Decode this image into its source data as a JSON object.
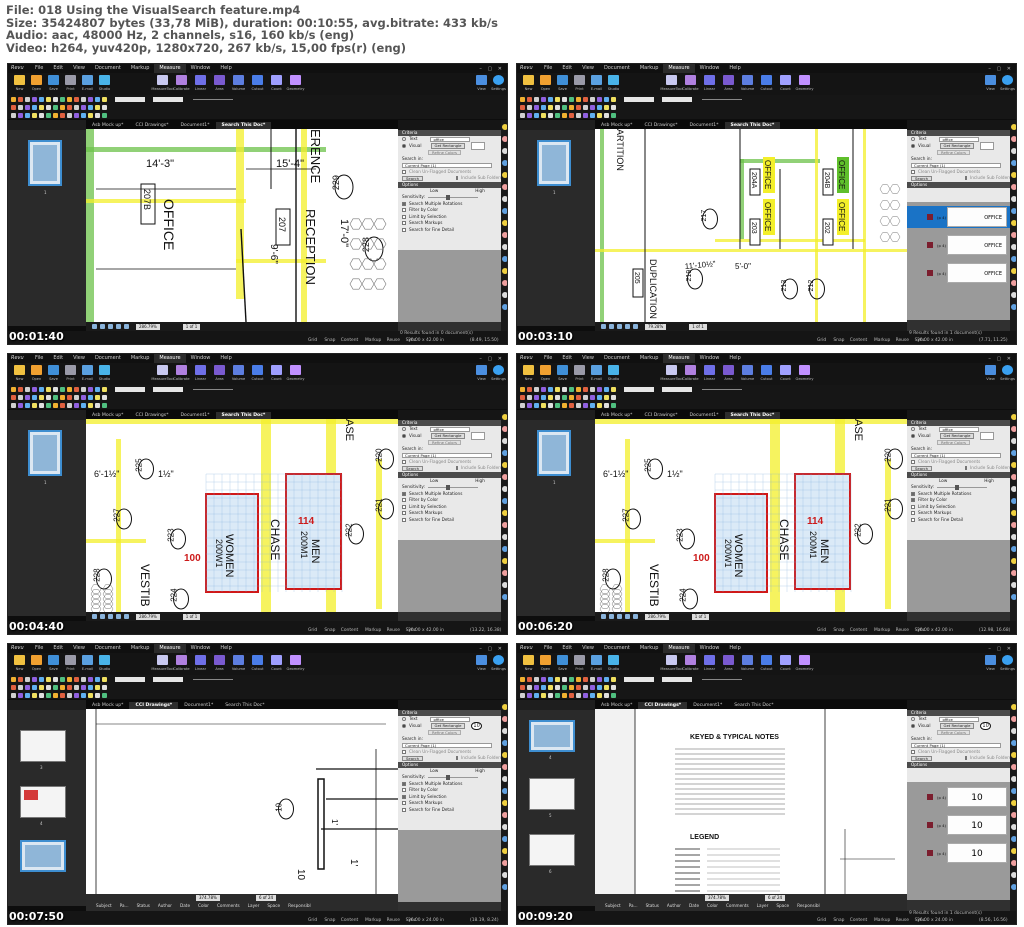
{
  "header": {
    "line1": "File: 018 Using the VisualSearch feature.mp4",
    "line2": "Size: 35424807 bytes (33,78 MiB), duration: 00:10:55, avg.bitrate: 433 kb/s",
    "line3": "Audio: aac, 48000 Hz, 2 channels, s16, 160 kb/s (eng)",
    "line4": "Video: h264, yuv420p, 1280x720, 267 kb/s, 15,00 fps(r) (eng)"
  },
  "app": {
    "logo": "Revu",
    "menu": [
      "File",
      "Edit",
      "View",
      "Document",
      "Markup",
      "Measure",
      "Window",
      "Help"
    ],
    "active_menu": "Measure",
    "ribbon_left": [
      "New",
      "Open",
      "Save",
      "Print",
      "E-mail",
      "Studio"
    ],
    "ribbon_measure": [
      "MeasureTool",
      "Calibrate",
      "Linear",
      "Area",
      "Volume",
      "Cutout",
      "Count",
      "Geometry"
    ],
    "ribbon_right": [
      "View",
      "Settings"
    ],
    "colors": {
      "accent": "#3e8ed0",
      "highlight_yellow": "#f3ef2a",
      "highlight_green": "#6cc24a",
      "result_swatch": "#7b1e2e",
      "select_blue": "#1a73c6"
    }
  },
  "search": {
    "section_criteria": "Criteria",
    "text_option": "Text",
    "visual_option": "Visual",
    "get_rect": "Get Rectangle",
    "refine": "Refine Colors",
    "search_in_label": "Search in:",
    "search_in_value": "Current Page (1)",
    "clean_label": "Clean Un-Flagged Documents",
    "search_btn": "Search",
    "include_sub": "Include Sub Folders",
    "section_options": "Options",
    "low": "Low",
    "high": "High",
    "sensitivity": "Sensitivity:",
    "opts": [
      "Search Multiple Rotations",
      "Filter by Color",
      "Limit by Selection",
      "Search Markups",
      "Search for Fine Detail"
    ],
    "query": "office",
    "result_label": "(p 4)"
  },
  "frames": [
    {
      "timestamp": "00:01:40",
      "tabs": [
        "Asb Mock up*",
        "CCI Drawings*",
        "Document1*",
        "Search This Doc*"
      ],
      "active_tab": 3,
      "zoom": "286.79%",
      "page": "1 of 1",
      "status_right": "0 Results found in 0 document(s)",
      "dims": "30.00 x 42.00 in",
      "coords": "(8.49, 15.50)",
      "visual_on": true,
      "checked": [
        true,
        false,
        false,
        false,
        false
      ],
      "labels": [
        "14'-3\"",
        "15'-4\"",
        "OFFICE",
        "207B",
        "207",
        "RECEPTION",
        "ERENCE",
        "229",
        "228",
        "17'-0\"",
        "9'-6\""
      ]
    },
    {
      "timestamp": "00:03:10",
      "tabs": [
        "Asb Mock up*",
        "CCI Drawings*",
        "Document1*",
        "Search This Doc*"
      ],
      "active_tab": 3,
      "zoom": "79.28%",
      "page": "1 of 1",
      "status_right": "9 Results found in 1 document(s)",
      "dims": "30.00 x 42.00 in",
      "coords": "(7.71, 11.25)",
      "visual_on": true,
      "checked": [
        true,
        false,
        false,
        false,
        false
      ],
      "labels": [
        "OFFICE",
        "OFFICE",
        "OFFICE",
        "OFFICE",
        "204A",
        "204B",
        "203",
        "202",
        "217",
        "219",
        "213",
        "212",
        "205",
        "DUPLICATION",
        "ARTITION"
      ]
    },
    {
      "timestamp": "00:04:40",
      "tabs": [
        "Asb Mock up*",
        "CCI Drawings*",
        "Document1*",
        "Search This Doc*"
      ],
      "active_tab": 3,
      "zoom": "286.79%",
      "page": "1 of 1",
      "status_right": "",
      "dims": "30.00 x 42.00 in",
      "coords": "(13.22, 16.38)",
      "visual_on": true,
      "checked": [
        true,
        false,
        false,
        false,
        false
      ],
      "labels": [
        "225",
        "227",
        "223",
        "224",
        "228",
        "222",
        "221",
        "220",
        "CHASE",
        "WOMEN",
        "MEN",
        "200W1",
        "200M1",
        "100",
        "114",
        "VESTIB",
        "6'-1½\"",
        "1½\"",
        "ASE"
      ]
    },
    {
      "timestamp": "00:06:20",
      "tabs": [
        "Asb Mock up*",
        "CCI Drawings*",
        "Document1*",
        "Search This Doc*"
      ],
      "active_tab": 3,
      "zoom": "286.79%",
      "page": "1 of 1",
      "status_right": "",
      "dims": "30.00 x 42.00 in",
      "coords": "(12.98, 16.68)",
      "visual_on": true,
      "checked": [
        true,
        true,
        false,
        false,
        false
      ],
      "labels": [
        "225",
        "227",
        "223",
        "224",
        "228",
        "222",
        "221",
        "220",
        "CHASE",
        "WOMEN",
        "MEN",
        "200W1",
        "200M1",
        "100",
        "114",
        "VESTIB",
        "6'-1½\"",
        "1½\"",
        "ASE"
      ]
    },
    {
      "timestamp": "00:07:50",
      "tabs": [
        "Asb Mock up*",
        "CCI Drawings*",
        "Document1*",
        "Search This Doc*"
      ],
      "active_tab": 1,
      "zoom": "374.78%",
      "page": "6 of 24",
      "status_right": "",
      "dims": "36.00 x 24.00 in",
      "coords": "(18.19, 8.24)",
      "visual_on": true,
      "checked": [
        true,
        false,
        true,
        false,
        false
      ],
      "query_badge": "10",
      "labels": [
        "10",
        "10",
        "1'",
        "1'"
      ],
      "markup_cols": [
        "Subject",
        "Pa...",
        "Status",
        "Author",
        "Date",
        "Color",
        "Comments",
        "Layer",
        "Space",
        "Responsibl"
      ],
      "thumb_pages": [
        "3",
        "4"
      ]
    },
    {
      "timestamp": "00:09:20",
      "tabs": [
        "Asb Mock up*",
        "CCI Drawings*",
        "Document1*",
        "Search This Doc*"
      ],
      "active_tab": 1,
      "zoom": "374.78%",
      "page": "6 of 24",
      "status_right": "9 Results found in 1 document(s)",
      "dims": "36.00 x 24.00 in",
      "coords": "(8.56, 16.56)",
      "visual_on": true,
      "checked": [
        true,
        false,
        true,
        false,
        false
      ],
      "query_badge": "10",
      "labels": [
        "KEYED & TYPICAL NOTES",
        "LEGEND",
        "10",
        "10",
        "10",
        "(p 4)",
        "(p 4)",
        "(p 4)"
      ],
      "markup_cols": [
        "Subject",
        "Pa...",
        "Status",
        "Author",
        "Date",
        "Color",
        "Comments",
        "Layer",
        "Space",
        "Responsibl"
      ],
      "thumb_pages": [
        "4",
        "5",
        "6"
      ]
    }
  ]
}
